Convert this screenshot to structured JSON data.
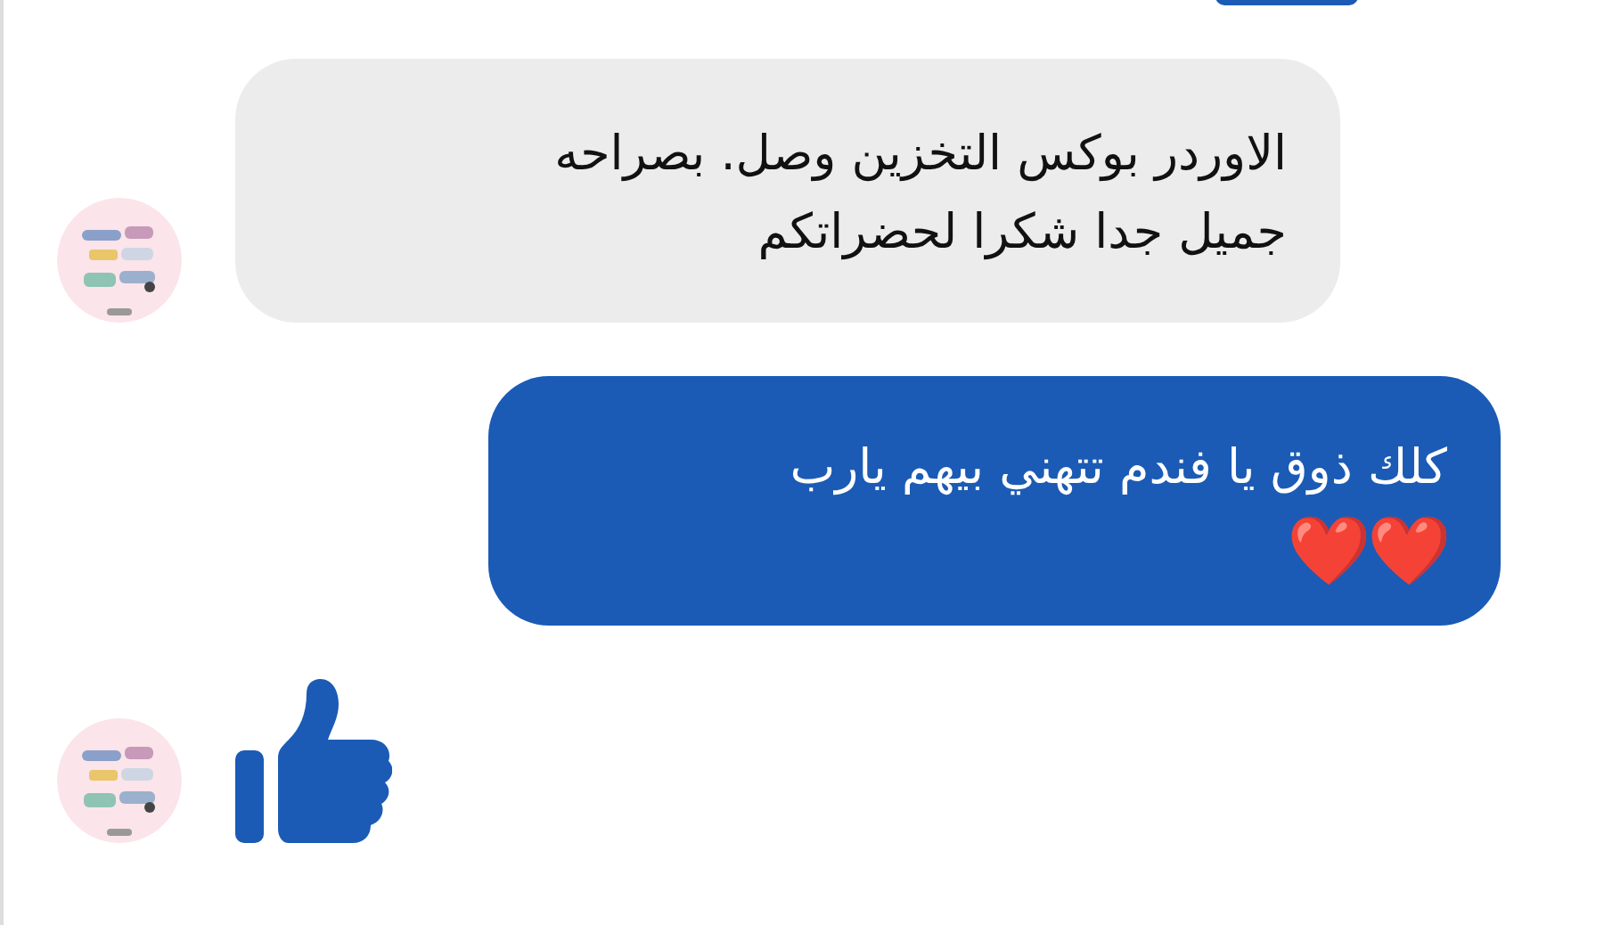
{
  "messages": [
    {
      "kind": "partial"
    },
    {
      "kind": "received",
      "lines": [
        "الاوردر بوكس التخزين وصل. بصراحه",
        "جميل جدا شكرا لحضراتكم"
      ]
    },
    {
      "kind": "sent",
      "lines": [
        "كلك ذوق يا فندم تتهني بيهم يارب",
        "❤️❤️"
      ]
    },
    {
      "kind": "like"
    }
  ]
}
